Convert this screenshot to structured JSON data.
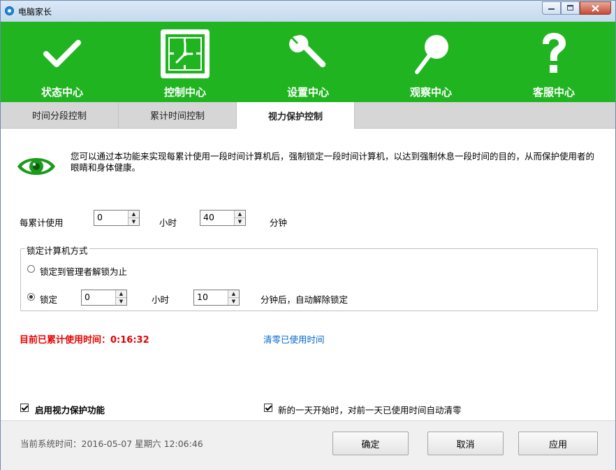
{
  "window": {
    "title": "电脑家长"
  },
  "nav": {
    "items": [
      {
        "label": "状态中心",
        "icon": "checkmark-icon"
      },
      {
        "label": "控制中心",
        "icon": "clock-icon",
        "active": true
      },
      {
        "label": "设置中心",
        "icon": "wrench-icon"
      },
      {
        "label": "观察中心",
        "icon": "magnifier-icon"
      },
      {
        "label": "客服中心",
        "icon": "question-icon"
      }
    ],
    "color": "#20b520"
  },
  "tabs": [
    {
      "label": "时间分段控制"
    },
    {
      "label": "累计时间控制"
    },
    {
      "label": "视力保护控制",
      "active": true
    }
  ],
  "content": {
    "description": "您可以通过本功能来实现每累计使用一段时间计算机后，强制锁定一段时间计算机，以达到强制休息一段时间的目的，从而保护使用者的眼睛和身体健康。",
    "usage_row": {
      "label": "每累计使用",
      "hours_value": "0",
      "hours_unit": "小时",
      "minutes_value": "40",
      "minutes_unit": "分钟"
    },
    "lock_group": {
      "title": "锁定计算机方式",
      "option1_label": "锁定到管理者解锁为止",
      "option2_label": "锁定",
      "lock_hours_value": "0",
      "lock_hours_unit": "小时",
      "lock_minutes_value": "10",
      "lock_minutes_unit": "分钟后，自动解除锁定",
      "selected": "option2"
    },
    "current_usage": "目前已累计使用时间：0:16:32",
    "clear_link": "清零已使用时间",
    "enable_checkbox": "启用视力保护功能",
    "reset_checkbox": "新的一天开始时，对前一天已使用时间自动清零"
  },
  "footer": {
    "system_time": "当前系统时间：2016-05-07 星期六  12:06:46",
    "ok": "确定",
    "cancel": "取消",
    "apply": "应用"
  }
}
